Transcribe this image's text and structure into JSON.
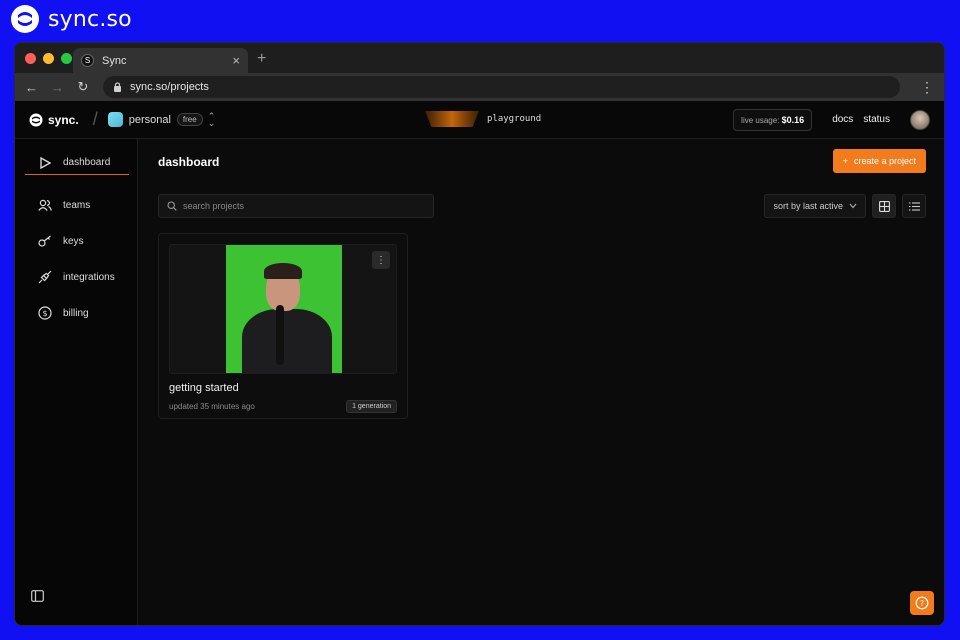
{
  "brand": {
    "name": "sync.so"
  },
  "browser": {
    "tab_title": "Sync",
    "tab_close": "×",
    "new_tab": "+",
    "url": "sync.so/projects",
    "traffic_colors": [
      "#ff5f57",
      "#febc2e",
      "#28c840"
    ]
  },
  "appbar": {
    "logo_text": "sync.",
    "workspace": "personal",
    "plan_badge": "free",
    "playground_label": "playground",
    "usage_label": "live usage:",
    "usage_value": "$0.16",
    "docs": "docs",
    "status": "status"
  },
  "sidebar": {
    "items": [
      {
        "label": "dashboard",
        "icon": "play-icon"
      },
      {
        "label": "teams",
        "icon": "users-icon"
      },
      {
        "label": "keys",
        "icon": "key-icon"
      },
      {
        "label": "integrations",
        "icon": "plug-icon"
      },
      {
        "label": "billing",
        "icon": "dollar-icon"
      }
    ]
  },
  "main": {
    "title": "dashboard",
    "create_label": "create a project",
    "search_placeholder": "search projects",
    "sort_label": "sort by last active"
  },
  "projects": [
    {
      "title": "getting started",
      "updated": "updated 35 minutes ago",
      "generations": "1 generation"
    }
  ],
  "colors": {
    "accent": "#f27b1c",
    "background": "#0b0b0b",
    "frame": "#1010f2",
    "greenscreen": "#3cc233"
  }
}
